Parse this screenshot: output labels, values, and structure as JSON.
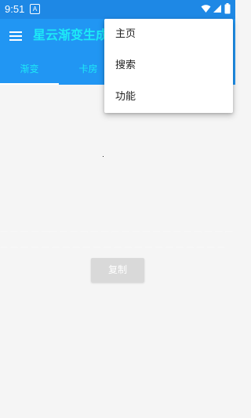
{
  "status_bar": {
    "time": "9:51",
    "notification_letter": "A",
    "icons": [
      "wifi-icon",
      "signal-icon",
      "battery-icon"
    ]
  },
  "app_bar": {
    "title": "星云渐变生成",
    "menu_icon": "hamburger-menu-icon"
  },
  "tabs": [
    {
      "label": "渐变",
      "selected": true
    },
    {
      "label": "卡房",
      "selected": false
    }
  ],
  "content": {
    "faint_text_1": "— — — —  ——  — — — — — — — — — — — — — — — — —",
    "faint_text_2": "— — — — — — — — — — — — — — — — — — — — — —",
    "copy_button": "复制"
  },
  "overflow_menu": {
    "items": [
      "主页",
      "搜索",
      "功能"
    ]
  },
  "colors": {
    "primary": "#2196f3",
    "status_bar": "#1e88e5",
    "accent_text": "#1de9f6",
    "background": "#f5f5f5"
  }
}
